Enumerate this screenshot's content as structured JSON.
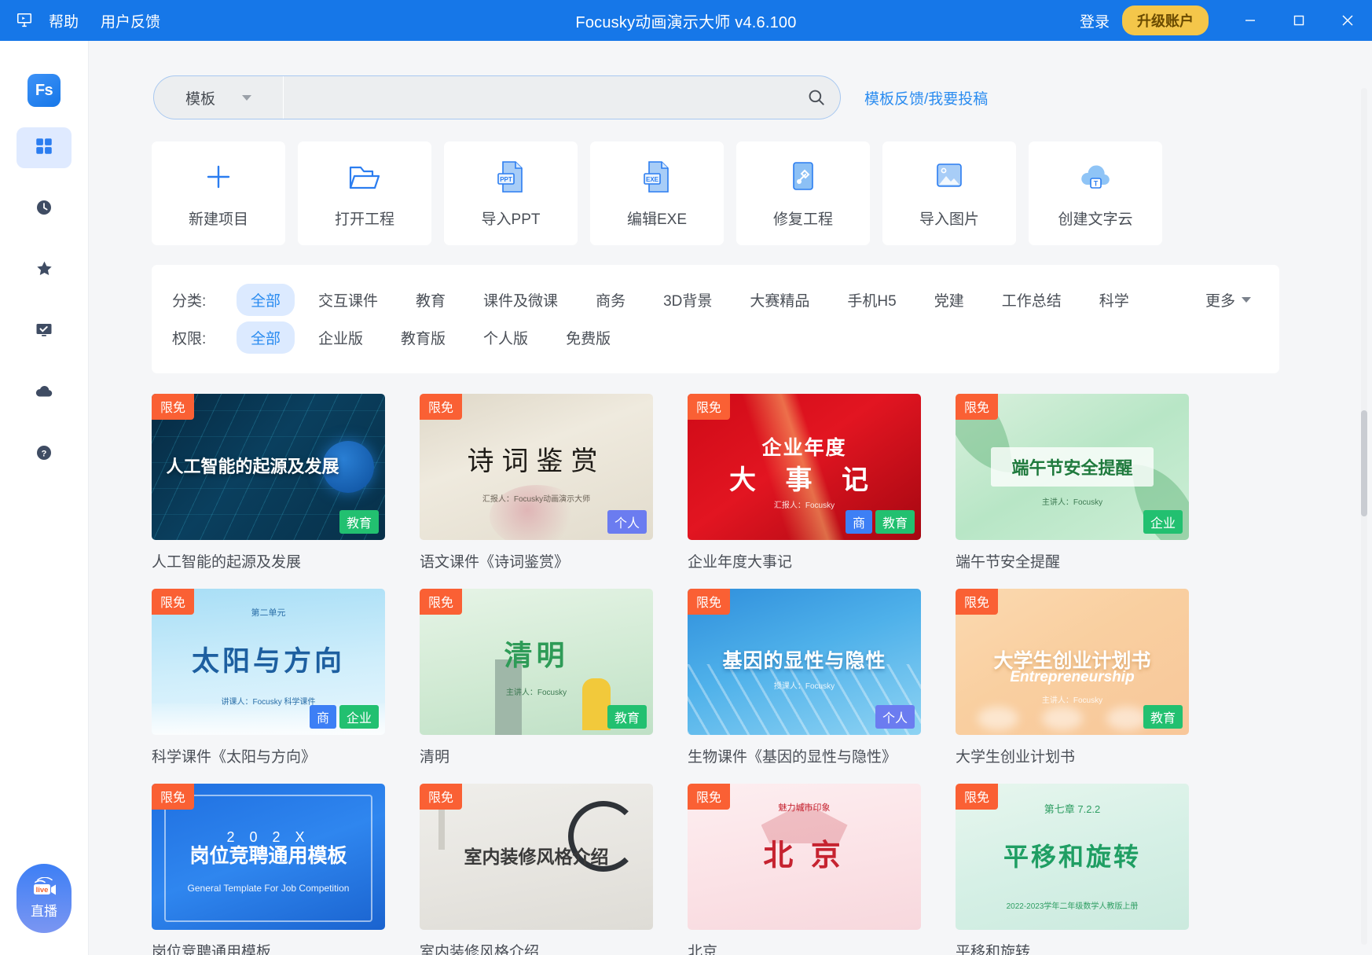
{
  "titlebar": {
    "app_icon": "presentation-icon",
    "menus": [
      {
        "label": "帮助",
        "name": "menu-help"
      },
      {
        "label": "用户反馈",
        "name": "menu-feedback"
      }
    ],
    "title": "Focusky动画演示大师 v4.6.100",
    "login_label": "登录",
    "upgrade_label": "升级账户",
    "minimize": "minimize-icon",
    "maximize": "maximize-icon",
    "close": "close-icon",
    "accent": "#1677e8",
    "upgrade_color": "#f4c64a"
  },
  "sidebar": {
    "logo": "Fs",
    "items": [
      {
        "name": "sidebar-item-templates",
        "icon": "grid-icon",
        "active": true
      },
      {
        "name": "sidebar-item-recent",
        "icon": "clock-icon",
        "active": false
      },
      {
        "name": "sidebar-item-favorites",
        "icon": "star-icon",
        "active": false
      },
      {
        "name": "sidebar-item-presentations",
        "icon": "monitor-check-icon",
        "active": false
      },
      {
        "name": "sidebar-item-cloud",
        "icon": "cloud-icon",
        "active": false
      },
      {
        "name": "sidebar-item-help",
        "icon": "question-circle-icon",
        "active": false
      }
    ],
    "live": {
      "label": "直播",
      "badge": "live"
    }
  },
  "search": {
    "category": "模板",
    "value": "",
    "placeholder": "",
    "search_icon": "search-icon",
    "feedback_link": "模板反馈/我要投稿"
  },
  "actions": [
    {
      "label": "新建项目",
      "icon": "plus-icon",
      "name": "new-project-button"
    },
    {
      "label": "打开工程",
      "icon": "folder-open-icon",
      "name": "open-project-button"
    },
    {
      "label": "导入PPT",
      "icon": "ppt-file-icon",
      "name": "import-ppt-button"
    },
    {
      "label": "编辑EXE",
      "icon": "exe-file-icon",
      "name": "edit-exe-button"
    },
    {
      "label": "修复工程",
      "icon": "tools-icon",
      "name": "repair-project-button"
    },
    {
      "label": "导入图片",
      "icon": "image-icon",
      "name": "import-image-button"
    },
    {
      "label": "创建文字云",
      "icon": "text-cloud-icon",
      "name": "create-word-cloud-button"
    }
  ],
  "filters": {
    "category": {
      "label": "分类:",
      "options": [
        "全部",
        "交互课件",
        "教育",
        "课件及微课",
        "商务",
        "3D背景",
        "大赛精品",
        "手机H5",
        "党建",
        "工作总结",
        "科学"
      ],
      "selected": "全部",
      "more_label": "更多"
    },
    "permission": {
      "label": "权限:",
      "options": [
        "全部",
        "企业版",
        "教育版",
        "个人版",
        "免费版"
      ],
      "selected": "全部"
    }
  },
  "templates": [
    {
      "name": "人工智能的起源及发展",
      "free_badge": "限免",
      "tags": [
        "教育"
      ],
      "thumb_title": "人工智能的起源及发展",
      "thumb_sub": "",
      "style": "t-ai"
    },
    {
      "name": "语文课件《诗词鉴赏》",
      "free_badge": "限免",
      "tags": [
        "个人"
      ],
      "thumb_title": "诗词鉴赏",
      "thumb_sub": "汇报人：Focusky动画演示大师",
      "style": "t-poem"
    },
    {
      "name": "企业年度大事记",
      "free_badge": "限免",
      "tags": [
        "商",
        "教育"
      ],
      "thumb_title": "企业年度",
      "thumb_title2": "大 事 记",
      "thumb_sub": "汇报人：Focusky",
      "style": "t-red"
    },
    {
      "name": "端午节安全提醒",
      "free_badge": "限免",
      "tags": [
        "企业"
      ],
      "thumb_title": "端午节安全提醒",
      "thumb_sub": "主讲人：Focusky",
      "style": "t-green"
    },
    {
      "name": "科学课件《太阳与方向》",
      "free_badge": "限免",
      "tags": [
        "商",
        "企业"
      ],
      "thumb_title": "太阳与方向",
      "thumb_top": "第二单元",
      "thumb_sub": "讲课人：Focusky    科学课件",
      "style": "t-sun"
    },
    {
      "name": "清明",
      "free_badge": "限免",
      "tags": [
        "教育"
      ],
      "thumb_title": "清明",
      "thumb_sub": "主讲人：Focusky",
      "style": "t-qm"
    },
    {
      "name": "生物课件《基因的显性与隐性》",
      "free_badge": "限免",
      "tags": [
        "个人"
      ],
      "thumb_title": "基因的显性与隐性",
      "thumb_sub": "授课人：Focusky",
      "style": "t-dna"
    },
    {
      "name": "大学生创业计划书",
      "free_badge": "限免",
      "tags": [
        "教育"
      ],
      "thumb_title": "大学生创业计划书",
      "thumb_en": "Entrepreneurship",
      "thumb_sub": "主讲人：Focusky",
      "style": "t-orange"
    },
    {
      "name": "岗位竞聘通用模板",
      "free_badge": "限免",
      "tags": [],
      "thumb_title": "岗位竞聘通用模板",
      "thumb_year": "2 0 2 X",
      "thumb_en": "General Template For Job Competition",
      "thumb_sub": "",
      "style": "t-blue"
    },
    {
      "name": "室内装修风格介绍",
      "free_badge": "限免",
      "tags": [],
      "thumb_title": "室内装修风格介绍",
      "thumb_sub": "",
      "style": "t-room"
    },
    {
      "name": "北京",
      "free_badge": "限免",
      "tags": [],
      "thumb_title": "北 京",
      "thumb_top": "魅力城市印象",
      "thumb_sub": "",
      "style": "t-bj"
    },
    {
      "name": "平移和旋转",
      "free_badge": "限免",
      "tags": [],
      "thumb_title": "平移和旋转",
      "thumb_top": "第七章  7.2.2",
      "thumb_sub": "2022-2023学年二年级数学人教版上册",
      "style": "t-move"
    }
  ]
}
